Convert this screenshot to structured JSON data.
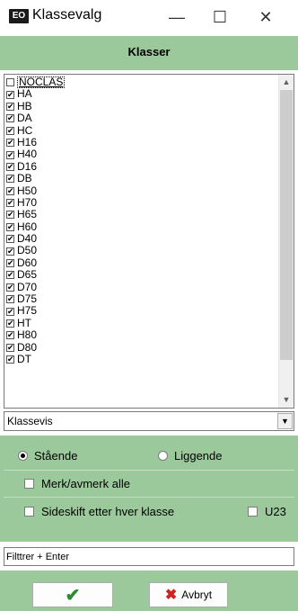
{
  "window": {
    "icon_text": "EO",
    "title": "Klassevalg",
    "minimize": "—",
    "maximize": "☐",
    "close": "✕"
  },
  "header": {
    "title": "Klasser"
  },
  "classes": [
    {
      "label": "NOCLAS",
      "checked": false
    },
    {
      "label": "HA",
      "checked": true
    },
    {
      "label": "HB",
      "checked": true
    },
    {
      "label": "DA",
      "checked": true
    },
    {
      "label": "HC",
      "checked": true
    },
    {
      "label": "H16",
      "checked": true
    },
    {
      "label": "H40",
      "checked": true
    },
    {
      "label": "D16",
      "checked": true
    },
    {
      "label": "DB",
      "checked": true
    },
    {
      "label": "H50",
      "checked": true
    },
    {
      "label": "H70",
      "checked": true
    },
    {
      "label": "H65",
      "checked": true
    },
    {
      "label": "H60",
      "checked": true
    },
    {
      "label": "D40",
      "checked": true
    },
    {
      "label": "D50",
      "checked": true
    },
    {
      "label": "D60",
      "checked": true
    },
    {
      "label": "D65",
      "checked": true
    },
    {
      "label": "D70",
      "checked": true
    },
    {
      "label": "D75",
      "checked": true
    },
    {
      "label": "H75",
      "checked": true
    },
    {
      "label": "HT",
      "checked": true
    },
    {
      "label": "H80",
      "checked": true
    },
    {
      "label": "D80",
      "checked": true
    },
    {
      "label": "DT",
      "checked": true
    }
  ],
  "sort_combo": {
    "value": "Klassevis"
  },
  "orientation": {
    "standing_label": "Stående",
    "lying_label": "Liggende",
    "selected": "standing"
  },
  "options": {
    "toggle_all_label": "Merk/avmerk alle",
    "page_break_label": "Sideskift etter hver klasse",
    "u23_label": "U23"
  },
  "filter": {
    "value": "Filttrer + Enter"
  },
  "buttons": {
    "ok_symbol": "✔",
    "cancel_icon": "✖",
    "cancel_label": "Avbryt"
  }
}
